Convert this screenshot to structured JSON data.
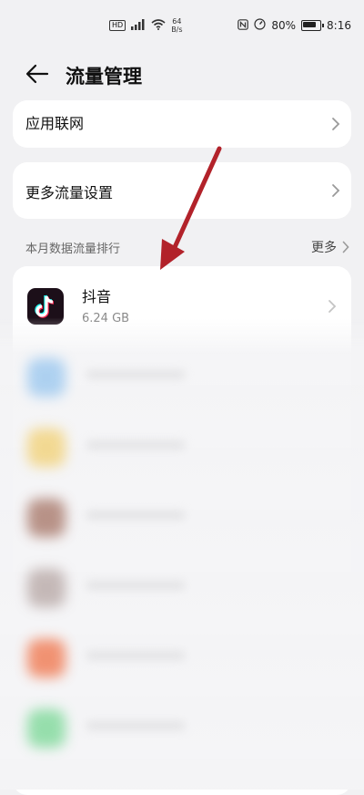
{
  "status_bar": {
    "hd_label": "HD",
    "speed_value": "64",
    "speed_unit": "B/s",
    "battery_percent": "80%",
    "battery_level": 0.8,
    "time": "8:16"
  },
  "header": {
    "title": "流量管理"
  },
  "menu": {
    "app_network_label": "应用联网",
    "more_settings_label": "更多流量设置"
  },
  "ranking": {
    "section_title": "本月数据流量排行",
    "more_label": "更多"
  },
  "apps": [
    {
      "name": "抖音",
      "usage": "6.24 GB",
      "icon": "tiktok-icon"
    }
  ],
  "blurred_rows": [
    {
      "icon_color": "#9cc8ef"
    },
    {
      "icon_color": "#f2d27a"
    },
    {
      "icon_color": "#a97a6c"
    },
    {
      "icon_color": "#b9aaa8"
    },
    {
      "icon_color": "#f07a52"
    },
    {
      "icon_color": "#7fd99a"
    }
  ],
  "colors": {
    "annotation_arrow": "#b2222a",
    "card_bg": "#ffffff",
    "page_bg": "#f1f1f3"
  }
}
